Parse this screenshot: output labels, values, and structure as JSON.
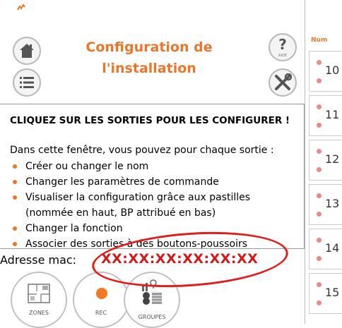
{
  "header": {
    "title_line1": "Configuration de",
    "title_line2": "l'installation",
    "help_label": "AIDE"
  },
  "info": {
    "heading": "CLIQUEZ SUR LES SORTIES POUR LES CONFIGURER !",
    "intro": "Dans cette fenêtre, vous pouvez pour chaque sortie :",
    "bullets": [
      "Créer ou changer le nom",
      "Changer les paramètres de commande",
      "Visualiser la configuration grâce aux pastilles",
      "Changer la fonction",
      "Associer des sorties à des boutons-poussoirs"
    ],
    "bullet3_continuation": "(nommée en haut, BP attribué en bas)"
  },
  "mac": {
    "label": "Adresse mac:",
    "value": "XX:XX:XX:XX:XX:XX"
  },
  "bottom_buttons": {
    "zones": "ZONES",
    "rec": "REC",
    "groupes": "GROUPES"
  },
  "outputs": {
    "column_header": "Num",
    "items": [
      "10",
      "11",
      "12",
      "13",
      "14",
      "15"
    ]
  },
  "colors": {
    "accent": "#e8772e",
    "mac_value": "#d01a1a",
    "annotation": "#e01d1d",
    "pin": "#e88a8a"
  },
  "icons": {
    "home": "home-icon",
    "list": "list-icon",
    "help": "help-icon",
    "tools": "tools-icon",
    "zones": "floorplan-icon",
    "rec": "record-dot-icon",
    "groupes": "groups-icon"
  }
}
